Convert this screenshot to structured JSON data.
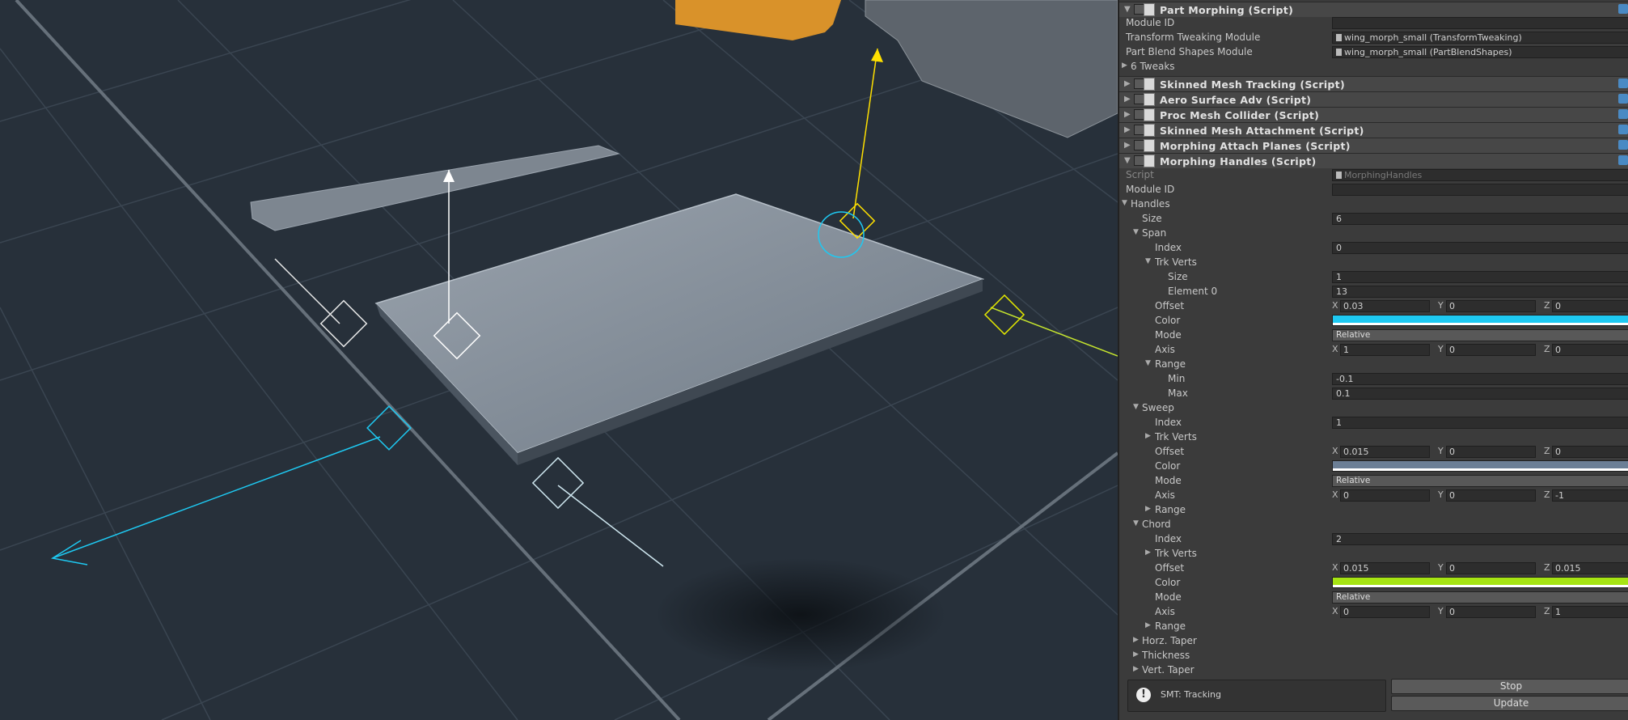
{
  "part_morphing": {
    "title": "Part Morphing (Script)",
    "rows": [
      {
        "label": "Module ID",
        "value": ""
      },
      {
        "label": "Transform Tweaking Module",
        "value": "wing_morph_small (TransformTweaking)"
      },
      {
        "label": "Part Blend Shapes Module",
        "value": "wing_morph_small (PartBlendShapes)"
      }
    ],
    "tweaks_label": "6 Tweaks"
  },
  "components": [
    "Skinned Mesh Tracking (Script)",
    "Aero Surface Adv (Script)",
    "Proc Mesh Collider (Script)",
    "Skinned Mesh Attachment (Script)",
    "Morphing Attach Planes (Script)"
  ],
  "morphing_handles": {
    "title": "Morphing Handles (Script)",
    "script_label": "Script",
    "script_value": "MorphingHandles",
    "module_id_label": "Module ID",
    "handles_label": "Handles",
    "size_label": "Size",
    "size_value": "6",
    "span": {
      "label": "Span",
      "index_label": "Index",
      "index": "0",
      "trk_label": "Trk Verts",
      "trk_size_label": "Size",
      "trk_size": "1",
      "element_label": "Element 0",
      "element": "13",
      "offset_label": "Offset",
      "offset": {
        "x": "0.03",
        "y": "0",
        "z": "0"
      },
      "color_label": "Color",
      "color": "#1ec9f2",
      "mode_label": "Mode",
      "mode": "Relative",
      "axis_label": "Axis",
      "axis": {
        "x": "1",
        "y": "0",
        "z": "0"
      },
      "range_label": "Range",
      "min_label": "Min",
      "min": "-0.1",
      "max_label": "Max",
      "max": "0.1"
    },
    "sweep": {
      "label": "Sweep",
      "index_label": "Index",
      "index": "1",
      "trk_label": "Trk Verts",
      "offset_label": "Offset",
      "offset": {
        "x": "0.015",
        "y": "0",
        "z": "0"
      },
      "color_label": "Color",
      "color": "#6c7f96",
      "mode_label": "Mode",
      "mode": "Relative",
      "axis_label": "Axis",
      "axis": {
        "x": "0",
        "y": "0",
        "z": "-1"
      },
      "range_label": "Range"
    },
    "chord": {
      "label": "Chord",
      "index_label": "Index",
      "index": "2",
      "trk_label": "Trk Verts",
      "offset_label": "Offset",
      "offset": {
        "x": "0.015",
        "y": "0",
        "z": "0.015"
      },
      "color_label": "Color",
      "color": "#a6e413",
      "mode_label": "Mode",
      "mode": "Relative",
      "axis_label": "Axis",
      "axis": {
        "x": "0",
        "y": "0",
        "z": "1"
      },
      "range_label": "Range"
    },
    "collapsed": [
      "Horz. Taper",
      "Thickness",
      "Vert. Taper"
    ]
  },
  "status": {
    "text": "SMT: Tracking",
    "icon": "warning-icon"
  },
  "buttons": {
    "stop": "Stop",
    "update": "Update"
  },
  "axis_letters": {
    "x": "X",
    "y": "Y",
    "z": "Z"
  }
}
